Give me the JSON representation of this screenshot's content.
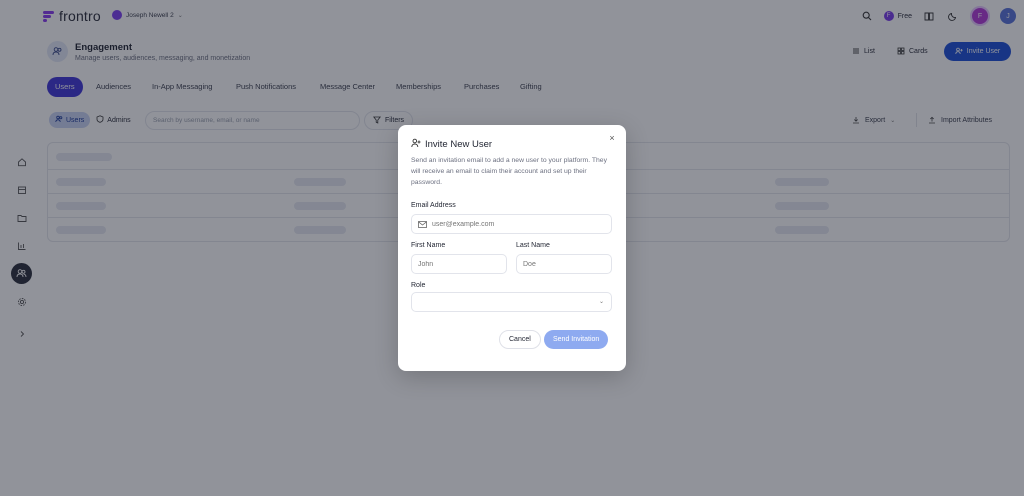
{
  "app": {
    "name": "frontro",
    "workspace": "Joseph Newell 2"
  },
  "topbar": {
    "plan_label": "Free",
    "plan_icon": "F",
    "avatar_initial": "F",
    "avatar2_initial": "J"
  },
  "header": {
    "title": "Engagement",
    "subtitle": "Manage users, audiences, messaging, and monetization",
    "list_label": "List",
    "cards_label": "Cards",
    "invite_label": "Invite User"
  },
  "tabs": [
    "Users",
    "Audiences",
    "In-App Messaging",
    "Push Notifications",
    "Message Center",
    "Memberships",
    "Purchases",
    "Gifting"
  ],
  "toolbar": {
    "users_label": "Users",
    "admins_label": "Admins",
    "search_placeholder": "Search by username, email, or name",
    "filters_label": "Filters",
    "export_label": "Export",
    "import_label": "Import Attributes"
  },
  "modal": {
    "title": "Invite New User",
    "description": "Send an invitation email to add a new user to your platform. They will receive an email to claim their account and set up their password.",
    "email_label": "Email Address",
    "email_placeholder": "user@example.com",
    "first_name_label": "First Name",
    "first_name_placeholder": "John",
    "last_name_label": "Last Name",
    "last_name_placeholder": "Doe",
    "role_label": "Role",
    "role_value": "",
    "cancel_label": "Cancel",
    "send_label": "Send Invitation",
    "close_glyph": "×"
  },
  "colors": {
    "accent": "#1b4fd8",
    "tab_active": "#3f35d8",
    "brand": "#8b3cf0",
    "send_disabled": "#8eaaf0"
  }
}
